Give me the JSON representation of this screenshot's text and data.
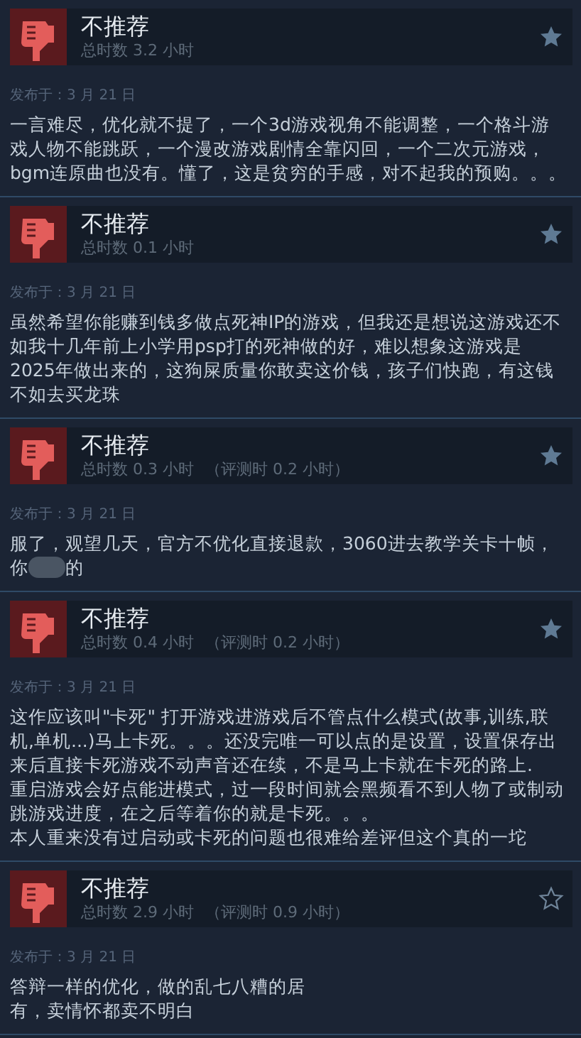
{
  "reviews": [
    {
      "verdict": "不推荐",
      "hours": "总时数 3.2 小时",
      "favorite": true,
      "posted": "发布于：3 月 21 日",
      "lines": [
        {
          "kind": "text",
          "text": "一言难尽，优化就不提了，一个3d游戏视角不能调整，一个格斗游"
        },
        {
          "kind": "text",
          "text": "戏人物不能跳跃，一个漫改游戏剧情全靠闪回，一个二次元游戏，"
        },
        {
          "kind": "text",
          "text": "bgm连原曲也没有。懂了，这是贫穷的手感，对不起我的预购。。。"
        }
      ]
    },
    {
      "verdict": "不推荐",
      "hours": "总时数 0.1 小时",
      "favorite": true,
      "posted": "发布于：3 月 21 日",
      "lines": [
        {
          "kind": "text",
          "text": "虽然希望你能赚到钱多做点死神IP的游戏，但我还是想说这游戏还不"
        },
        {
          "kind": "text",
          "text": "如我十几年前上小学用psp打的死神做的好，难以想象这游戏是"
        },
        {
          "kind": "text",
          "text": "2025年做出来的，这狗屎质量你敢卖这价钱，孩子们快跑，有这钱"
        },
        {
          "kind": "text",
          "text": "不如去买龙珠"
        }
      ]
    },
    {
      "verdict": "不推荐",
      "hours": "总时数 0.3 小时",
      "review_hours": "（评测时 0.2 小时）",
      "favorite": true,
      "posted": "发布于：3 月 21 日",
      "lines": [
        {
          "kind": "text",
          "text": "服了，观望几天，官方不优化直接退款，3060进去教学关卡十帧，"
        },
        {
          "kind": "redacted",
          "before": "你",
          "after": "的"
        }
      ]
    },
    {
      "verdict": "不推荐",
      "hours": "总时数 0.4 小时",
      "review_hours": "（评测时 0.2 小时）",
      "favorite": true,
      "posted": "发布于：3 月 21 日",
      "lines": [
        {
          "kind": "text",
          "text": "这作应该叫\"卡死\" 打开游戏进游戏后不管点什么模式(故事,训练,联"
        },
        {
          "kind": "text",
          "text": "机,单机...)马上卡死。。。还没完唯一可以点的是设置，设置保存出"
        },
        {
          "kind": "text",
          "text": "来后直接卡死游戏不动声音还在续，不是马上卡就在卡死的路上."
        },
        {
          "kind": "text",
          "text": "重启游戏会好点能进模式，过一段时间就会黑频看不到人物了或制动"
        },
        {
          "kind": "text",
          "text": "跳游戏进度，在之后等着你的就是卡死。。。"
        },
        {
          "kind": "text",
          "text": "本人重来没有过启动或卡死的问题也很难给差评但这个真的一坨"
        }
      ]
    },
    {
      "verdict": "不推荐",
      "hours": "总时数 2.9 小时",
      "review_hours": "（评测时 0.9 小时）",
      "favorite": false,
      "posted": "发布于：3 月 21 日",
      "lines": [
        {
          "kind": "text",
          "text": "答辩一样的优化，做的乱七八糟的居"
        },
        {
          "kind": "text",
          "text": "有，卖情怀都卖不明白"
        }
      ]
    }
  ]
}
